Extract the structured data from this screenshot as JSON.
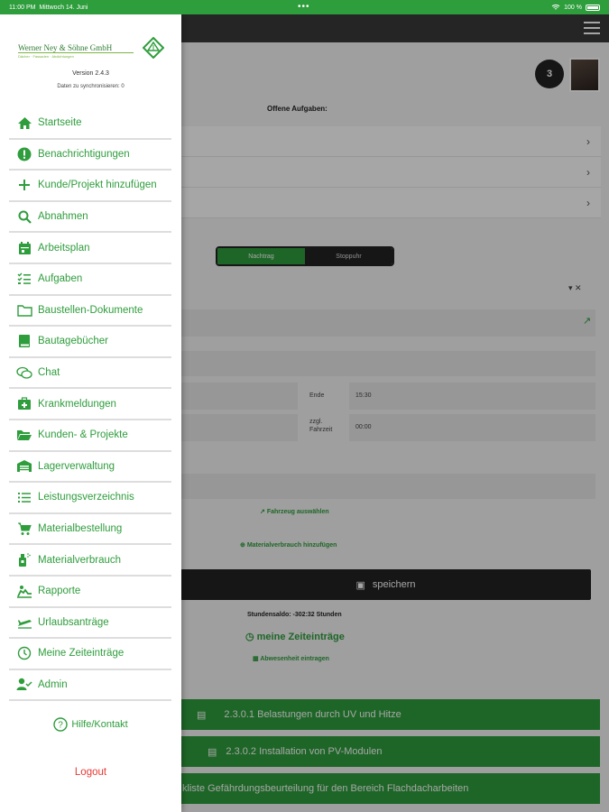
{
  "status_bar": {
    "time": "11:00 PM",
    "date": "Mittwoch 14. Juni",
    "dots": "•••",
    "battery": "100 %"
  },
  "drawer": {
    "logo": {
      "company": "Werner Ney & Söhne GmbH",
      "tagline": "Dächer · Fassaden · Abdichtungen"
    },
    "version": "Version 2.4.3",
    "sync_status": "Daten zu synchronisieren: 0",
    "menu": [
      {
        "label": "Startseite",
        "icon": "home-icon"
      },
      {
        "label": "Benachrichtigungen",
        "icon": "alert-circle-icon"
      },
      {
        "label": "Kunde/Projekt hinzufügen",
        "icon": "plus-icon"
      },
      {
        "label": "Abnahmen",
        "icon": "search-icon"
      },
      {
        "label": "Arbeitsplan",
        "icon": "calendar-icon"
      },
      {
        "label": "Aufgaben",
        "icon": "checklist-icon"
      },
      {
        "label": "Baustellen-Dokumente",
        "icon": "folder-icon"
      },
      {
        "label": "Bautagebücher",
        "icon": "book-icon"
      },
      {
        "label": "Chat",
        "icon": "chat-icon"
      },
      {
        "label": "Krankmeldungen",
        "icon": "medical-kit-icon"
      },
      {
        "label": "Kunden- & Projekte",
        "icon": "folder-open-icon"
      },
      {
        "label": "Lagerverwaltung",
        "icon": "warehouse-icon"
      },
      {
        "label": "Leistungsverzeichnis",
        "icon": "list-icon"
      },
      {
        "label": "Materialbestellung",
        "icon": "cart-icon"
      },
      {
        "label": "Materialverbrauch",
        "icon": "spray-icon"
      },
      {
        "label": "Rapporte",
        "icon": "rapport-icon"
      },
      {
        "label": "Urlaubsanträge",
        "icon": "plane-icon"
      },
      {
        "label": "Meine Zeiteinträge",
        "icon": "clock-icon"
      },
      {
        "label": "Admin",
        "icon": "user-check-icon"
      }
    ],
    "help_label": "Hilfe/Kontakt",
    "logout_label": "Logout"
  },
  "background": {
    "notification_count": "3",
    "open_tasks_title": "Offene Aufgaben:",
    "toggle": {
      "left": "Nachtrag",
      "right": "Stoppuhr"
    },
    "end_label": "Ende",
    "end_value": "15:30",
    "travel_label": "zzgl. Fahrzeit",
    "travel_value": "00:00",
    "vehicle_link": "Fahrzeug auswählen",
    "material_link": "Materialverbrauch hinzufügen",
    "save_label": "speichern",
    "balance": "Stundensaldo: -302:32 Stunden",
    "my_times": "meine Zeiteinträge",
    "absence": "Abwesenheit eintragen",
    "docs": [
      "2.3.0.1 Belastungen durch UV und Hitze",
      "2.3.0.2 Installation von PV-Modulen",
      "kliste Gefährdungsbeurteilung für den Bereich Flachdacharbeiten"
    ]
  },
  "colors": {
    "accent": "#2e9d3c",
    "logout": "#e53935",
    "dark": "#222222"
  }
}
